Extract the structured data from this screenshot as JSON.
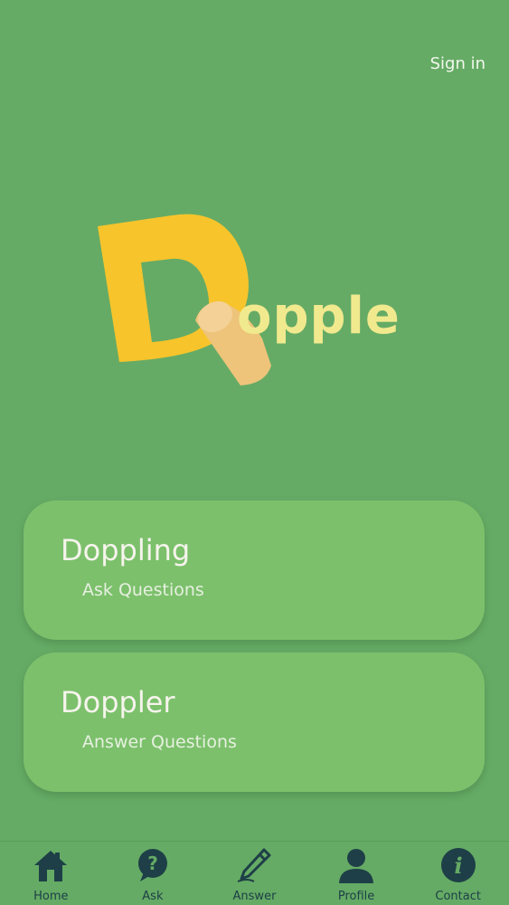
{
  "header": {
    "sign_in_label": "Sign in"
  },
  "logo": {
    "letter": "D",
    "word": "opple",
    "icon": "finger-tap-icon",
    "colors": {
      "letter": "#f7c42c",
      "word": "#f1e98e",
      "finger": "#eec47a"
    }
  },
  "cards": [
    {
      "title": "Doppling",
      "subtitle": "Ask Questions"
    },
    {
      "title": "Doppler",
      "subtitle": "Answer Questions"
    }
  ],
  "tabbar": {
    "items": [
      {
        "label": "Home",
        "icon": "home-icon"
      },
      {
        "label": "Ask",
        "icon": "question-bubble-icon"
      },
      {
        "label": "Answer",
        "icon": "pencil-icon"
      },
      {
        "label": "Profile",
        "icon": "person-icon"
      },
      {
        "label": "Contact",
        "icon": "info-icon"
      }
    ]
  },
  "colors": {
    "background": "#65ab65",
    "card": "#7cc06c",
    "tab_icon": "#1e3f47"
  }
}
